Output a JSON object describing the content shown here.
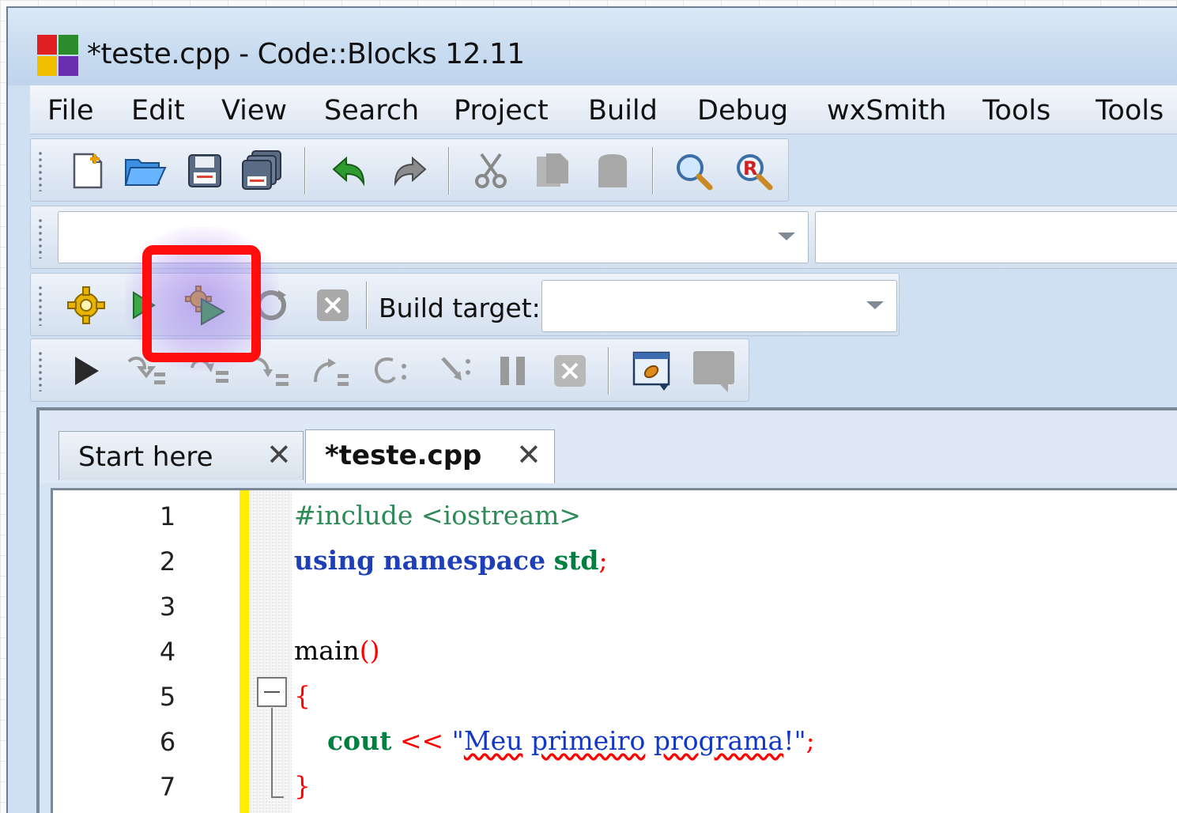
{
  "window": {
    "title": "*teste.cpp - Code::Blocks 12.11"
  },
  "menu": [
    "File",
    "Edit",
    "View",
    "Search",
    "Project",
    "Build",
    "Debug",
    "wxSmith",
    "Tools",
    "Tools"
  ],
  "toolbar_main": {
    "icons": [
      "new-file-icon",
      "open-folder-icon",
      "save-icon",
      "save-all-icon",
      "undo-icon",
      "redo-icon",
      "cut-icon",
      "copy-icon",
      "paste-icon",
      "find-icon",
      "replace-icon"
    ]
  },
  "toolbar_build": {
    "icons": [
      "build-gear-icon",
      "run-icon",
      "build-and-run-icon",
      "rebuild-icon",
      "abort-icon"
    ],
    "build_target_label": "Build target:",
    "build_target_value": "",
    "highlighted": "build-and-run-icon",
    "highlight_color": "#ff0d0d"
  },
  "toolbar_debug": {
    "icons": [
      "debug-continue-icon",
      "run-to-cursor-icon",
      "next-line-icon",
      "step-into-icon",
      "step-out-icon",
      "next-instruction-icon",
      "step-into-instruction-icon",
      "pause-icon",
      "stop-debugger-icon",
      "debugging-windows-icon",
      "various-info-icon"
    ]
  },
  "tabs": [
    {
      "label": "Start here",
      "close": "✕",
      "active": false
    },
    {
      "label": "*teste.cpp",
      "close": "✕",
      "active": true
    }
  ],
  "editor": {
    "line_numbers": [
      "1",
      "2",
      "3",
      "4",
      "5",
      "6",
      "7"
    ],
    "lines": {
      "l1_pre": "#include <iostream>",
      "l2_kw1": "using",
      "l2_kw2": "namespace",
      "l2_id": "std",
      "l2_semi": ";",
      "l4_name": "main",
      "l4_parens": "()",
      "l5": "{",
      "l6_indent": "    ",
      "l6_id": "cout",
      "l6_op": "<<",
      "l6_q1": "\"",
      "l6_w1": "Meu",
      "l6_w2": "primeiro",
      "l6_w3": "programa",
      "l6_tail": "!\"",
      "l6_semi": ";",
      "l7": "}"
    }
  },
  "colors": {
    "preprocessor": "#2e8b57",
    "keyword": "#1e3fb5",
    "identifier": "#008040",
    "operator": "#ff0000",
    "string": "#1238c8",
    "changed_line_bar": "#ffee00",
    "saved_line_bar": "#22dd44"
  }
}
